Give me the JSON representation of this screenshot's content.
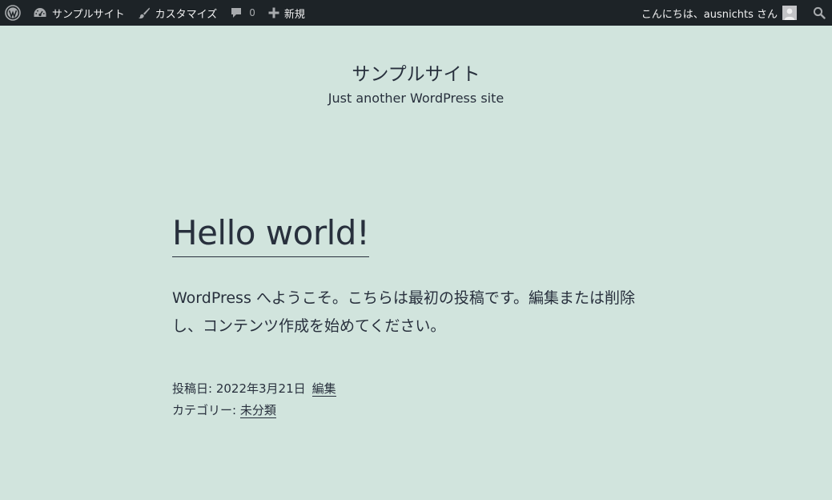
{
  "adminbar": {
    "site_name": "サンプルサイト",
    "customize": "カスタマイズ",
    "comments_count": "0",
    "new": "新規",
    "greeting": "こんにちは、ausnichts さん"
  },
  "header": {
    "title": "サンプルサイト",
    "description": "Just another WordPress site"
  },
  "post": {
    "title": "Hello world!",
    "content": "WordPress へようこそ。こちらは最初の投稿です。編集または削除し、コンテンツ作成を始めてください。",
    "posted_label": "投稿日: ",
    "date": "2022年3月21日",
    "edit": "編集",
    "category_label": "カテゴリー: ",
    "category": "未分類"
  },
  "colors": {
    "background": "#d1e4dd",
    "adminbar": "#1d2327",
    "text": "#28303d"
  }
}
